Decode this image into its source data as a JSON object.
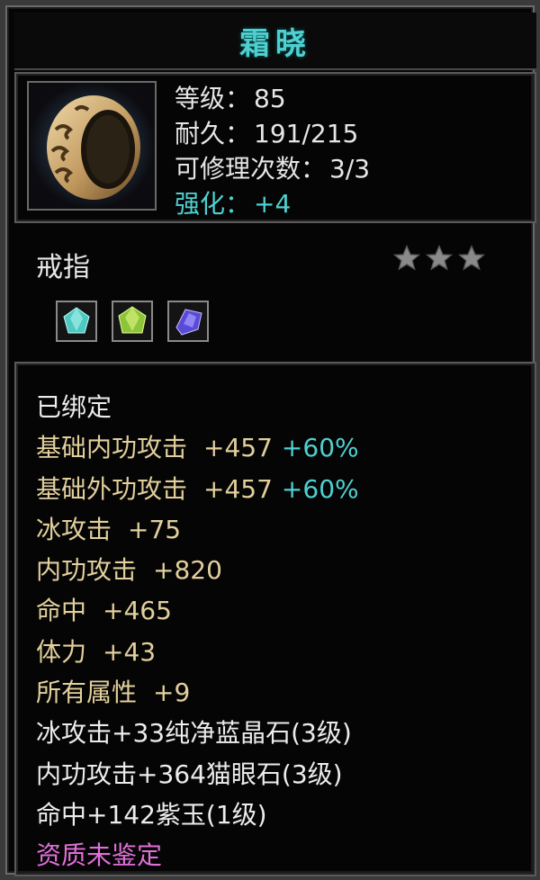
{
  "item": {
    "name": "霜晓",
    "icon": "ring-icon",
    "stats": [
      {
        "label": "等级：",
        "value": "85"
      },
      {
        "label": "耐久：",
        "value": "191/215"
      },
      {
        "label": "可修理次数：",
        "value": "3/3"
      },
      {
        "label": "强化：",
        "value": "+4"
      }
    ],
    "type": "戒指",
    "stars": 3,
    "gems": [
      "cyan-gem-icon",
      "green-gem-icon",
      "purple-gem-icon"
    ]
  },
  "attributes": {
    "bound": "已绑定",
    "base_internal": {
      "label": "基础内功攻击",
      "value": "+457",
      "pct": "+60%"
    },
    "base_external": {
      "label": "基础外功攻击",
      "value": "+457",
      "pct": "+60%"
    },
    "ice_attack": {
      "label": "冰攻击",
      "value": "+75"
    },
    "internal_attack": {
      "label": "内功攻击",
      "value": "+820"
    },
    "hit": {
      "label": "命中",
      "value": "+465"
    },
    "stamina": {
      "label": "体力",
      "value": "+43"
    },
    "all_attr": {
      "label": "所有属性",
      "value": "+9"
    },
    "gem1": "冰攻击+33纯净蓝晶石(3级)",
    "gem2": "内功攻击+364猫眼石(3级)",
    "gem3": "命中+142紫玉(1级)",
    "quality": "资质未鉴定"
  },
  "colors": {
    "title": "#4fd0d0",
    "gold": "#e2cf9c",
    "pink": "#e070d8"
  }
}
